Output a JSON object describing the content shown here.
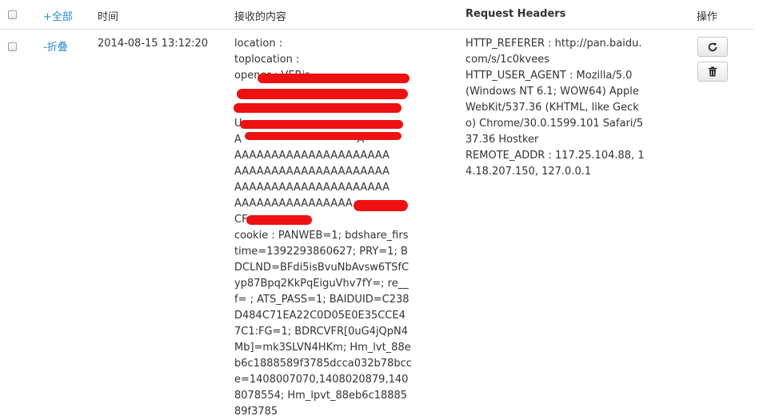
{
  "header": {
    "expand_all": "+全部",
    "col_time": "时间",
    "col_content": "接收的内容",
    "col_headers": "Request Headers",
    "col_actions": "操作"
  },
  "row": {
    "collapse": "-折叠",
    "time": "2014-08-15 13:12:20",
    "content": "location :\ntoplocation :\nopener : VERjs                              \n                                    \n                                    \nU                                    \nA                                   A\nAAAAAAAAAAAAAAAAAAAAA\nAAAAAAAAAAAAAAAAAAAAA\nAAAAAAAAAAAAAAAAAAAAA\nAAAAAAAAAAAAAAAA\nCF\ncookie : PANWEB=1; bdshare_firstime=1392293860627; PRY=1; BDCLND=BFdi5isBvuNbAvsw6TSfCyp87Bpq2KkPqEiguVhv7fY=; re__f= ; ATS_PASS=1; BAIDUID=C238D484C71EA22C0D05E0E35CCE47C1:FG=1; BDRCVFR[0uG4jQpN4Mb]=mk3SLVN4HKm; Hm_lvt_88eb6c1888589f3785dcca032b78bcce=1408007070,1408020879,1408078554; Hm_lpvt_88eb6c1888589f3785",
    "headers": "HTTP_REFERER : http://pan.baidu.com/s/1c0kvees\nHTTP_USER_AGENT : Mozilla/5.0 (Windows NT 6.1; WOW64) AppleWebKit/537.36 (KHTML, like Gecko) Chrome/30.0.1599.101 Safari/537.36 Hostker\nREMOTE_ADDR : 117.25.104.88, 14.18.207.150, 127.0.0.1"
  },
  "icons": {
    "refresh": "refresh-icon",
    "delete": "trash-icon"
  },
  "colors": {
    "link": "#2a8bcc",
    "redaction": "#ee1111",
    "border": "#dddddd"
  }
}
